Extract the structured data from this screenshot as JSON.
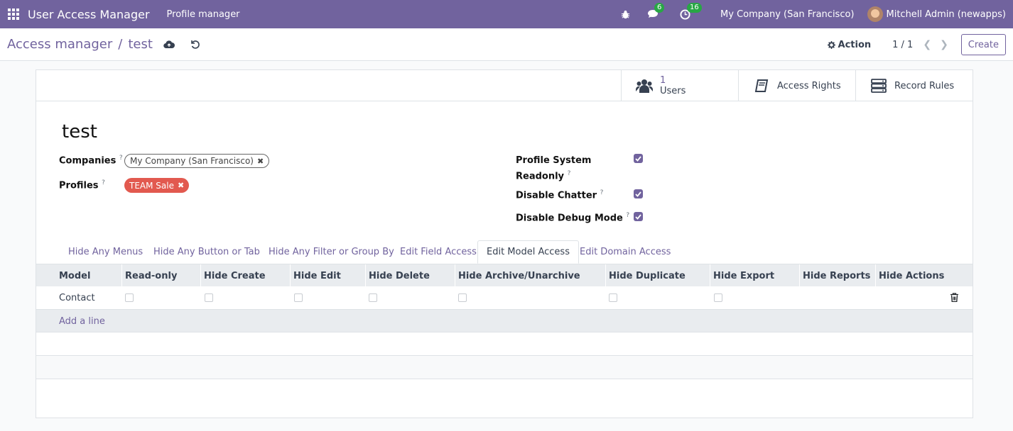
{
  "navbar": {
    "apps_icon": "grid-icon",
    "app_title": "User Access Manager",
    "menu": "Profile manager",
    "debug_icon": "bug-icon",
    "messages_count": "6",
    "activities_count": "16",
    "company": "My Company (San Francisco)",
    "user": "Mitchell Admin (newapps)"
  },
  "control_panel": {
    "breadcrumb_parent": "Access manager",
    "breadcrumb_sep": "/",
    "breadcrumb_current": "test",
    "action_label": "Action",
    "pager": "1 / 1",
    "create_label": "Create"
  },
  "button_box": {
    "users_count": "1",
    "users_label": "Users",
    "access_rights_label": "Access Rights",
    "record_rules_label": "Record Rules"
  },
  "record": {
    "title": "test",
    "companies_label": "Companies",
    "companies_tag": "My Company (San Francisco)",
    "profiles_label": "Profiles",
    "profiles_tag": "TEAM Sale",
    "help_mark": "?",
    "profile_readonly_label_1": "Profile System",
    "profile_readonly_label_2": "Readonly",
    "disable_chatter_label": "Disable Chatter",
    "disable_debug_label": "Disable Debug Mode",
    "profile_readonly": true,
    "disable_chatter": true,
    "disable_debug": true
  },
  "tabs": [
    {
      "label": "Hide Any Menus",
      "active": false
    },
    {
      "label": "Hide Any Button or Tab",
      "active": false
    },
    {
      "label": "Hide Any Filter or Group By",
      "active": false
    },
    {
      "label": "Edit Field Access",
      "active": false
    },
    {
      "label": "Edit Model Access",
      "active": true
    },
    {
      "label": "Edit Domain Access",
      "active": false
    }
  ],
  "table": {
    "columns": [
      "Model",
      "Read-only",
      "Hide Create",
      "Hide Edit",
      "Hide Delete",
      "Hide Archive/Unarchive",
      "Hide Duplicate",
      "Hide Export",
      "Hide Reports",
      "Hide Actions"
    ],
    "rows": [
      {
        "model": "Contact",
        "read_only": false,
        "hide_create": false,
        "hide_edit": false,
        "hide_delete": false,
        "hide_archive": false,
        "hide_duplicate": false,
        "hide_export": false
      }
    ],
    "add_line": "Add a line"
  },
  "colors": {
    "brand": "#71639e",
    "tag_red": "#e2594f",
    "badge_green": "#28a745"
  }
}
